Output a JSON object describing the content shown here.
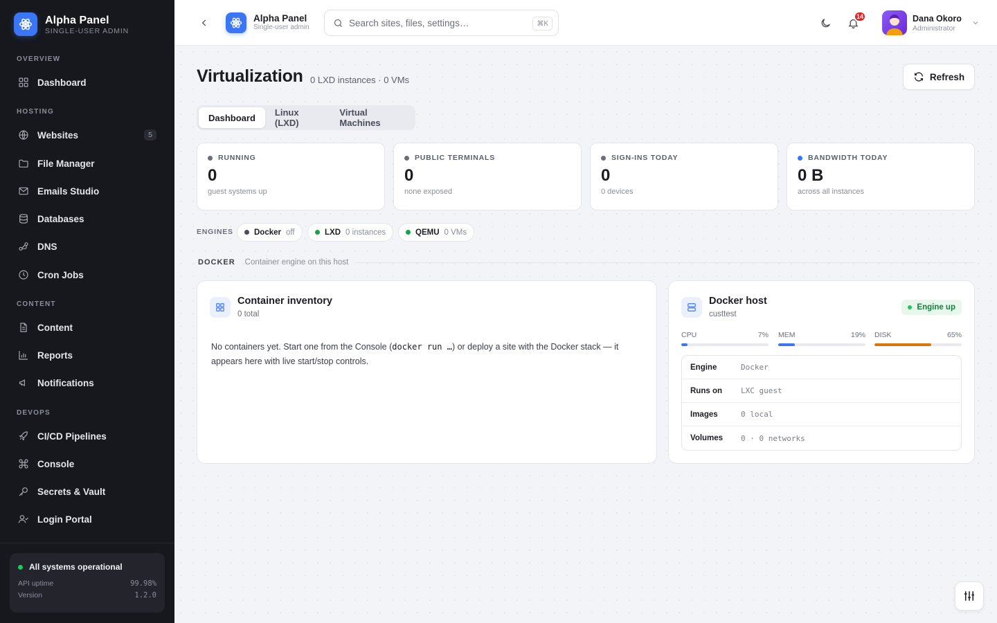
{
  "brand": {
    "title": "Alpha Panel",
    "subtitle": "SINGLE-USER ADMIN"
  },
  "sidebar": {
    "sections": [
      {
        "label": "OVERVIEW"
      },
      {
        "label": "HOSTING"
      },
      {
        "label": "CONTENT"
      },
      {
        "label": "DEVOPS"
      }
    ],
    "items": [
      {
        "label": "Dashboard",
        "icon": "grid-icon"
      },
      {
        "label": "Websites",
        "icon": "globe-icon",
        "badge": "5"
      },
      {
        "label": "File Manager",
        "icon": "folder-icon"
      },
      {
        "label": "Emails Studio",
        "icon": "mail-icon"
      },
      {
        "label": "Databases",
        "icon": "database-icon"
      },
      {
        "label": "DNS",
        "icon": "dns-icon"
      },
      {
        "label": "Cron Jobs",
        "icon": "clock-icon"
      },
      {
        "label": "Content",
        "icon": "document-icon"
      },
      {
        "label": "Reports",
        "icon": "bar-chart-icon"
      },
      {
        "label": "Notifications",
        "icon": "megaphone-icon"
      },
      {
        "label": "CI/CD Pipelines",
        "icon": "rocket-icon"
      },
      {
        "label": "Console",
        "icon": "command-icon"
      },
      {
        "label": "Secrets & Vault",
        "icon": "key-icon"
      },
      {
        "label": "Login Portal",
        "icon": "user-check-icon"
      }
    ],
    "status": {
      "title": "All systems operational",
      "uptime_label": "API uptime",
      "uptime_value": "99.98%",
      "version_label": "Version",
      "version_value": "1.2.0"
    }
  },
  "topbar": {
    "brand_title": "Alpha Panel",
    "brand_subtitle": "Single-user admin",
    "search_placeholder": "Search sites, files, settings…",
    "search_shortcut": "⌘K",
    "notifications_count": "14",
    "user": {
      "name": "Dana Okoro",
      "role": "Administrator"
    }
  },
  "page": {
    "title": "Virtualization",
    "subtitle": "0 LXD instances · 0 VMs",
    "refresh_label": "Refresh",
    "tabs": [
      "Dashboard",
      "Linux (LXD)",
      "Virtual Machines"
    ],
    "active_tab": "Dashboard",
    "stats": [
      {
        "label": "RUNNING",
        "value": "0",
        "hint": "guest systems up",
        "dot_color": "#6b6f7b"
      },
      {
        "label": "PUBLIC TERMINALS",
        "value": "0",
        "hint": "none exposed",
        "dot_color": "#6b6f7b"
      },
      {
        "label": "SIGN-INS TODAY",
        "value": "0",
        "hint": "0 devices",
        "dot_color": "#6b6f7b"
      },
      {
        "label": "BANDWIDTH TODAY",
        "value": "0 B",
        "hint": "across all instances",
        "dot_color": "#3b76f6"
      }
    ],
    "engines_label": "ENGINES",
    "engines": [
      {
        "name": "Docker",
        "status": "off",
        "dot_color": "#4a4e5a"
      },
      {
        "name": "LXD",
        "status": "0 instances",
        "dot_color": "#16a34a"
      },
      {
        "name": "QEMU",
        "status": "0 VMs",
        "dot_color": "#16a34a"
      }
    ],
    "section": {
      "title": "DOCKER",
      "subtitle": "Container engine on this host"
    },
    "inventory": {
      "title": "Container inventory",
      "subtitle": "0 total",
      "text_before": "No containers yet. Start one from the Console (",
      "code": "docker run …",
      "text_after": ") or deploy a site with the Docker stack — it appears here with live start/stop controls."
    },
    "docker_host": {
      "title": "Docker host",
      "subtitle": "custtest",
      "badge": "Engine up",
      "meters": [
        {
          "label": "CPU",
          "value": "7%",
          "fraction": 0.07,
          "color": "#3b76f6"
        },
        {
          "label": "MEM",
          "value": "19%",
          "fraction": 0.19,
          "color": "#3b76f6"
        },
        {
          "label": "DISK",
          "value": "65%",
          "fraction": 0.65,
          "color": "#d97706"
        }
      ],
      "rows": [
        {
          "key": "Engine",
          "value": "Docker"
        },
        {
          "key": "Runs on",
          "value": "LXC guest"
        },
        {
          "key": "Images",
          "value": "0 local"
        },
        {
          "key": "Volumes",
          "value": "0 · 0 networks"
        }
      ]
    }
  }
}
